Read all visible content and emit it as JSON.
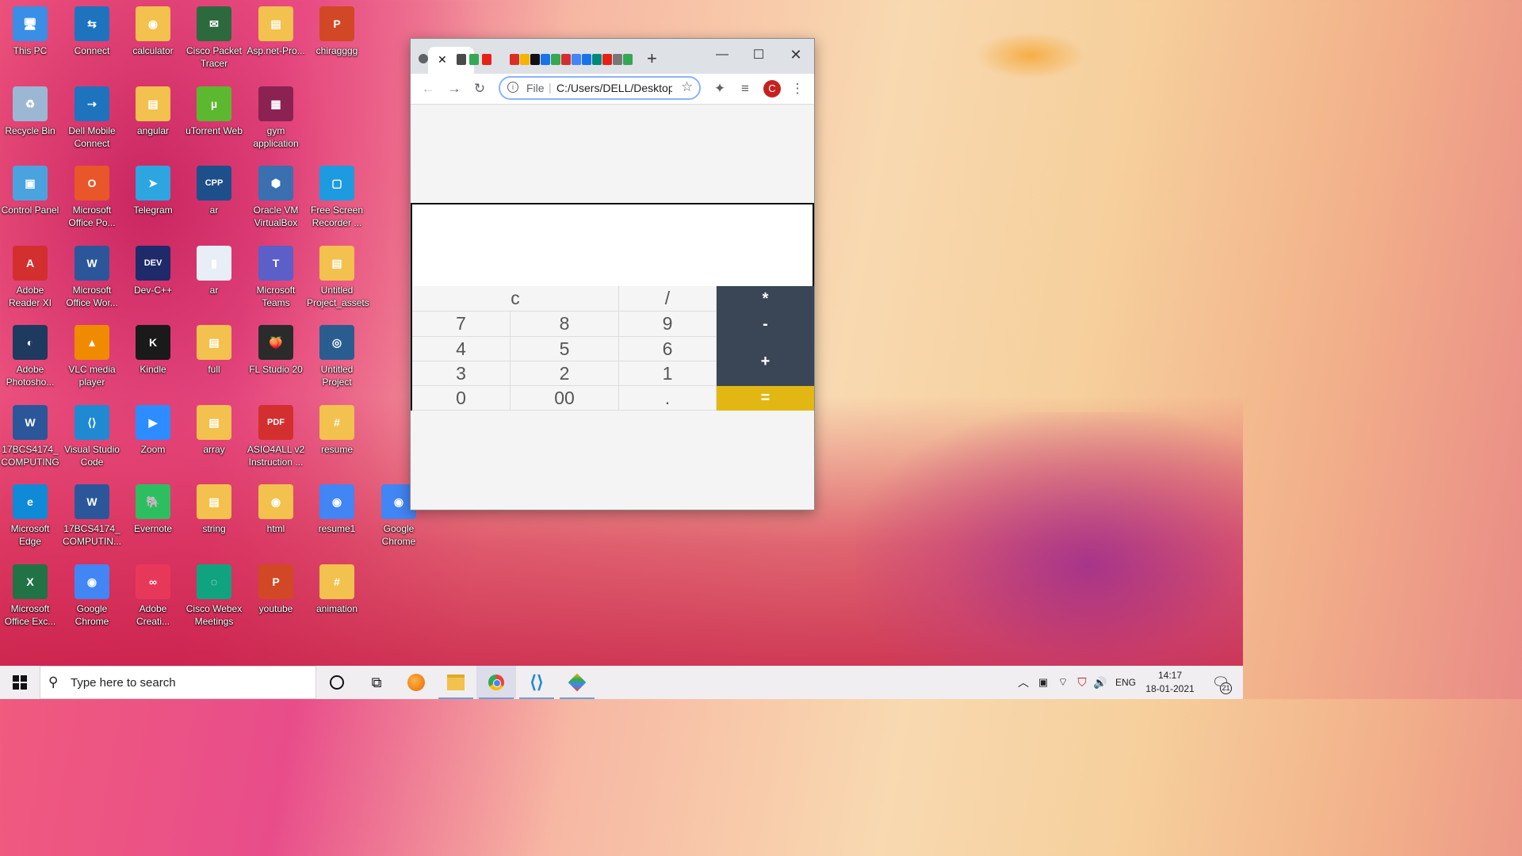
{
  "desktop": {
    "icons": [
      {
        "label": "This PC",
        "icon": "computer-icon",
        "color": "#3a8ee6",
        "glyph": "🖥"
      },
      {
        "label": "Connect",
        "icon": "connect-icon",
        "color": "#1e73be",
        "glyph": "⇆"
      },
      {
        "label": "calculator",
        "icon": "chrome-folder-icon",
        "color": "#f2c14e",
        "glyph": "◉"
      },
      {
        "label": "Cisco Packet Tracer",
        "icon": "cisco-icon",
        "color": "#2c6a3e",
        "glyph": "✉"
      },
      {
        "label": "Asp.net-Pro...",
        "icon": "folder-icon",
        "color": "#f2c14e",
        "glyph": "▤"
      },
      {
        "label": "chiragggg",
        "icon": "powerpoint-icon",
        "color": "#d24726",
        "glyph": "P"
      },
      {
        "label": "Recycle Bin",
        "icon": "recycle-bin-icon",
        "color": "#9bb7d4",
        "glyph": "♻"
      },
      {
        "label": "Dell Mobile Connect",
        "icon": "dell-connect-icon",
        "color": "#1e73be",
        "glyph": "⇢"
      },
      {
        "label": "angular",
        "icon": "folder-icon",
        "color": "#f2c14e",
        "glyph": "▤"
      },
      {
        "label": "uTorrent Web",
        "icon": "utorrent-icon",
        "color": "#5cb82e",
        "glyph": "µ"
      },
      {
        "label": "gym application",
        "icon": "winrar-icon",
        "color": "#8b2252",
        "glyph": "▦"
      },
      {
        "label": "Control Panel",
        "icon": "control-panel-icon",
        "color": "#4aa3df",
        "glyph": "▣"
      },
      {
        "label": "Microsoft Office Po...",
        "icon": "office-icon",
        "color": "#e8562a",
        "glyph": "O"
      },
      {
        "label": "Telegram",
        "icon": "telegram-icon",
        "color": "#2ca5e0",
        "glyph": "➤"
      },
      {
        "label": "ar",
        "icon": "cpp-file-icon",
        "color": "#1d4f8a",
        "glyph": "CPP"
      },
      {
        "label": "Oracle VM VirtualBox",
        "icon": "virtualbox-icon",
        "color": "#3a6fb0",
        "glyph": "⬢"
      },
      {
        "label": "Free Screen Recorder ...",
        "icon": "screen-recorder-icon",
        "color": "#1e9be0",
        "glyph": "▢"
      },
      {
        "label": "Adobe Reader XI",
        "icon": "adobe-reader-icon",
        "color": "#d32f2f",
        "glyph": "A"
      },
      {
        "label": "Microsoft Office Wor...",
        "icon": "word-icon",
        "color": "#2b579a",
        "glyph": "W"
      },
      {
        "label": "Dev-C++",
        "icon": "devcpp-icon",
        "color": "#1e2a6a",
        "glyph": "DEV"
      },
      {
        "label": "ar",
        "icon": "file-icon",
        "color": "#e8eef6",
        "glyph": "▮"
      },
      {
        "label": "Microsoft Teams",
        "icon": "teams-icon",
        "color": "#5b5fc7",
        "glyph": "T"
      },
      {
        "label": "Untitled Project_assets",
        "icon": "folder-icon",
        "color": "#f2c14e",
        "glyph": "▤"
      },
      {
        "label": "Adobe Photosho...",
        "icon": "photoshop-icon",
        "color": "#1e3a5f",
        "glyph": "◐"
      },
      {
        "label": "VLC media player",
        "icon": "vlc-icon",
        "color": "#f08a00",
        "glyph": "▲"
      },
      {
        "label": "Kindle",
        "icon": "kindle-icon",
        "color": "#1a1a1a",
        "glyph": "K"
      },
      {
        "label": "full",
        "icon": "folder-icon",
        "color": "#f2c14e",
        "glyph": "▤"
      },
      {
        "label": "FL Studio 20",
        "icon": "fl-studio-icon",
        "color": "#2b2b2b",
        "glyph": "🍑"
      },
      {
        "label": "Untitled Project",
        "icon": "video-project-icon",
        "color": "#2a5d8f",
        "glyph": "◎"
      },
      {
        "label": "17BCS4174_ COMPUTING",
        "icon": "word-doc-icon",
        "color": "#2b579a",
        "glyph": "W"
      },
      {
        "label": "Visual Studio Code",
        "icon": "vscode-icon",
        "color": "#1f8ad2",
        "glyph": "⟨⟩"
      },
      {
        "label": "Zoom",
        "icon": "zoom-icon",
        "color": "#2d8cff",
        "glyph": "▶"
      },
      {
        "label": "array",
        "icon": "folder-icon",
        "color": "#f2c14e",
        "glyph": "▤"
      },
      {
        "label": "ASIO4ALL v2 Instruction ...",
        "icon": "pdf-icon",
        "color": "#d32f2f",
        "glyph": "PDF"
      },
      {
        "label": "resume",
        "icon": "csharp-folder-icon",
        "color": "#f2c14e",
        "glyph": "#"
      },
      {
        "label": "Microsoft Edge",
        "icon": "edge-icon",
        "color": "#0f8ad6",
        "glyph": "e"
      },
      {
        "label": "17BCS4174_ COMPUTIN...",
        "icon": "word-doc-icon",
        "color": "#2b579a",
        "glyph": "W"
      },
      {
        "label": "Evernote",
        "icon": "evernote-icon",
        "color": "#2dbe60",
        "glyph": "🐘"
      },
      {
        "label": "string",
        "icon": "folder-icon",
        "color": "#f2c14e",
        "glyph": "▤"
      },
      {
        "label": "html",
        "icon": "chrome-folder-icon",
        "color": "#f2c14e",
        "glyph": "◉"
      },
      {
        "label": "resume1",
        "icon": "chrome-icon",
        "color": "#4285f4",
        "glyph": "◉"
      },
      {
        "label": "Google Chrome",
        "icon": "chrome-icon",
        "color": "#4285f4",
        "glyph": "◉"
      },
      {
        "label": "Microsoft Office Exc...",
        "icon": "excel-icon",
        "color": "#217346",
        "glyph": "X"
      },
      {
        "label": "Google Chrome",
        "icon": "chrome-icon",
        "color": "#4285f4",
        "glyph": "◉"
      },
      {
        "label": "Adobe Creati...",
        "icon": "creative-cloud-icon",
        "color": "#e8385a",
        "glyph": "∞"
      },
      {
        "label": "Cisco Webex Meetings",
        "icon": "webex-icon",
        "color": "#10a37f",
        "glyph": "◌"
      },
      {
        "label": "youtube",
        "icon": "powerpoint-icon",
        "color": "#d24726",
        "glyph": "P"
      },
      {
        "label": "animation",
        "icon": "csharp-folder-icon",
        "color": "#f2c14e",
        "glyph": "#"
      }
    ]
  },
  "browser": {
    "new_tab": "+",
    "close_tab": "✕",
    "minimize": "—",
    "maximize": "☐",
    "close": "✕",
    "url_scheme": "File",
    "url": "C:/Users/DELL/Desktop",
    "profile_initial": "C",
    "tab_favicons": [
      "#4a4a4a",
      "#34a853",
      "#e62117",
      "#d93025",
      "#f4b400",
      "#111111",
      "#1a73e8",
      "#34a853",
      "#d32f2f",
      "#4285f4",
      "#1a73e8",
      "#00897b",
      "#e62117",
      "#777777",
      "#34a853"
    ]
  },
  "calculator": {
    "display": "",
    "keys": {
      "clear": "c",
      "divide": "/",
      "multiply": "*",
      "seven": "7",
      "eight": "8",
      "nine": "9",
      "minus": "-",
      "four": "4",
      "five": "5",
      "six": "6",
      "plus": "+",
      "three": "3",
      "two": "2",
      "one": "1",
      "zero": "0",
      "double_zero": "00",
      "dot": ".",
      "equals": "="
    }
  },
  "taskbar": {
    "search_placeholder": "Type here to search",
    "language": "ENG",
    "time": "14:17",
    "date": "18-01-2021",
    "notification_count": "21"
  }
}
